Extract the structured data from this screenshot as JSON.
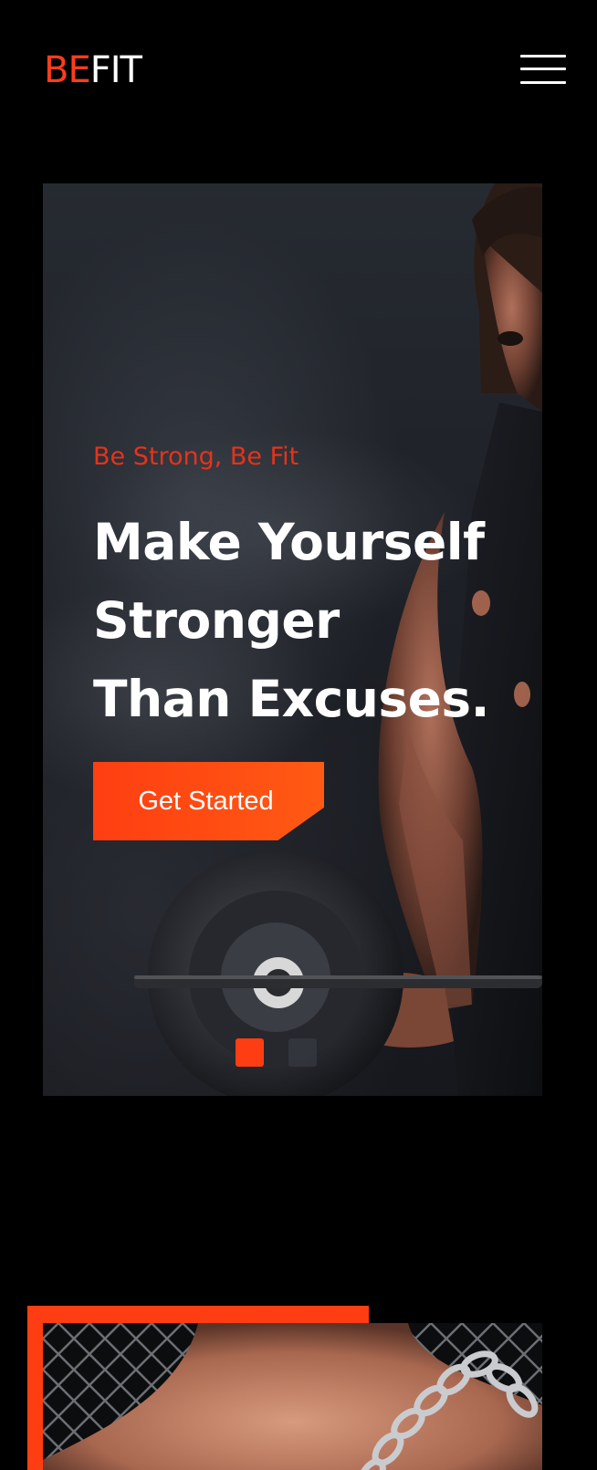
{
  "brand": {
    "logo_part1": "BE",
    "logo_part2": "FIT"
  },
  "nav": {
    "menu_icon": "hamburger-menu-icon"
  },
  "hero": {
    "tagline": "Be Strong, Be Fit",
    "headline_lines": [
      "Make Yourself",
      "Stronger",
      "Than Excuses."
    ],
    "cta_label": "Get Started",
    "active_slide": 1,
    "slide_count": 2
  },
  "colors": {
    "accent": "#ff3d12",
    "background": "#000000",
    "text": "#ffffff",
    "tagline": "#e4331b"
  }
}
